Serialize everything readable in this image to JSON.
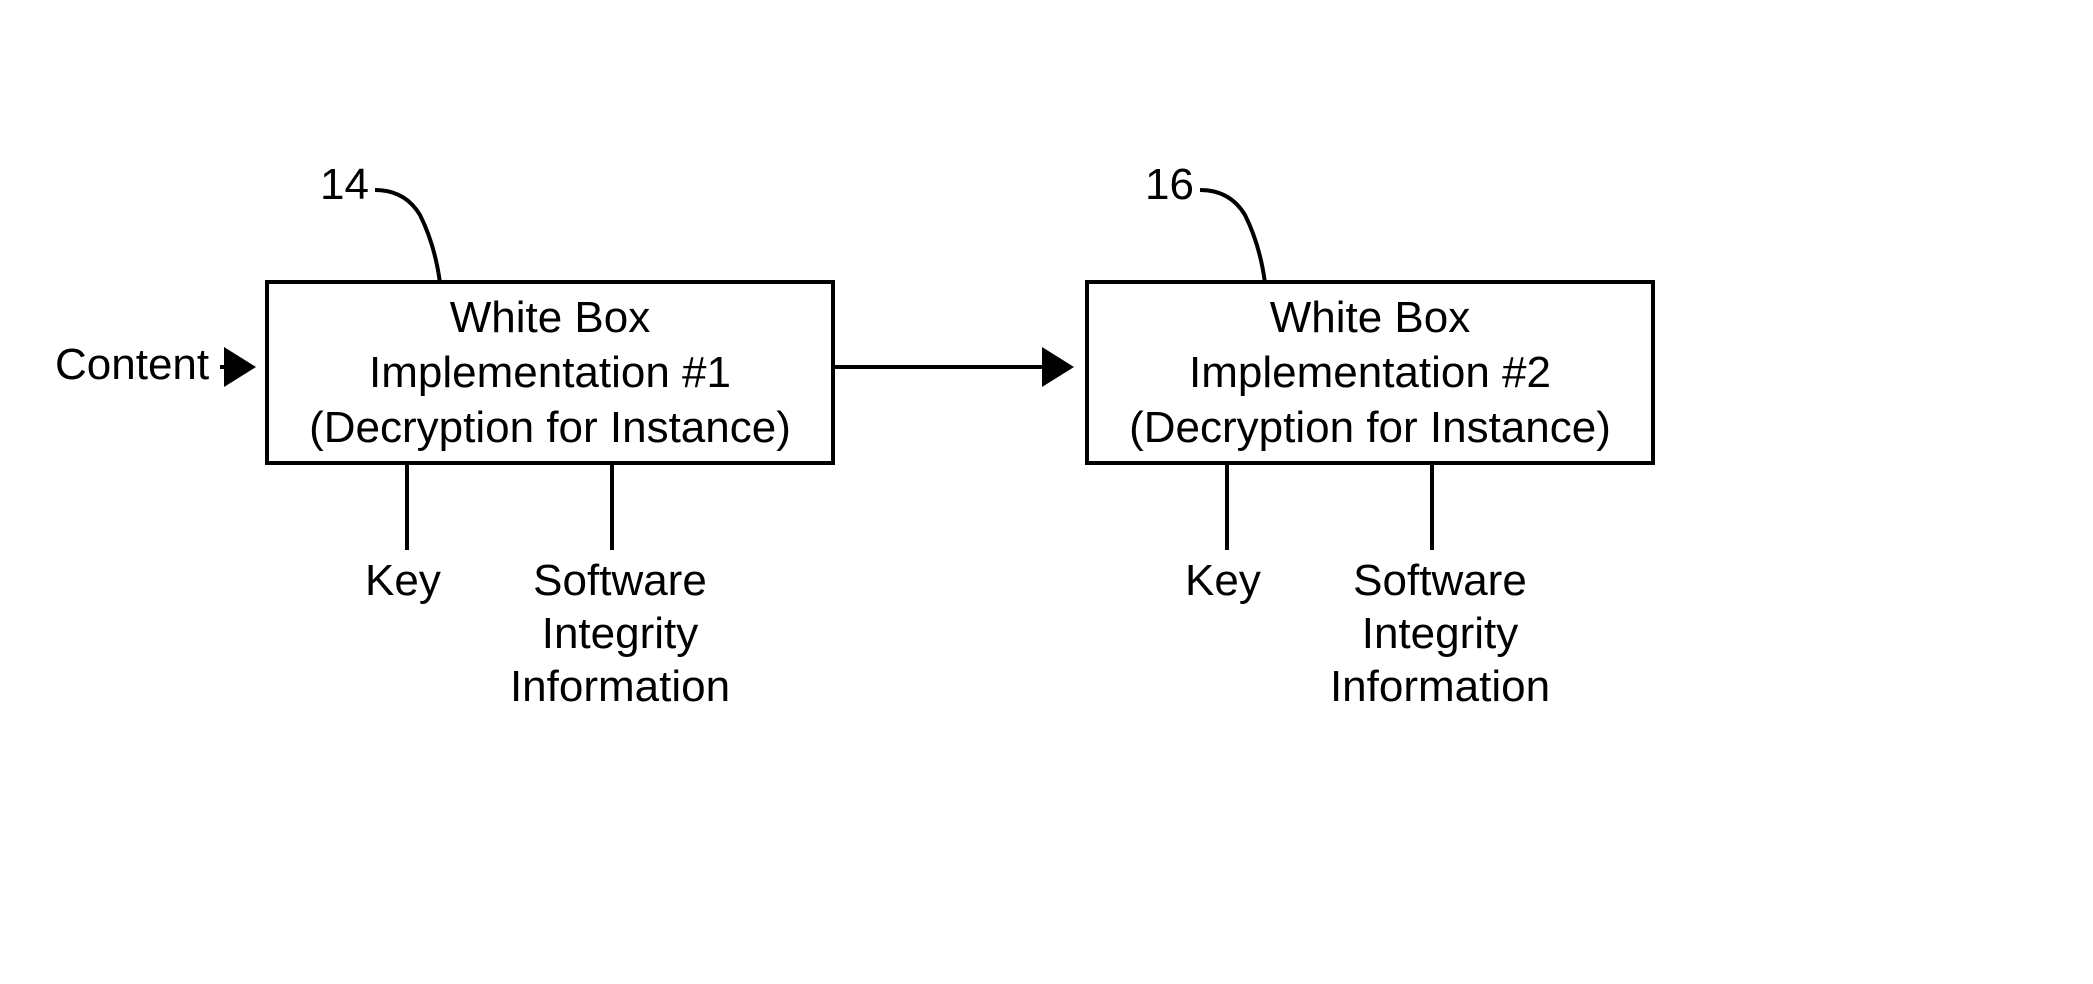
{
  "inputLabel": "Content",
  "box1": {
    "refNum": "14",
    "line1": "White Box",
    "line2": "Implementation #1",
    "line3": "(Decryption for Instance)"
  },
  "box2": {
    "refNum": "16",
    "line1": "White Box",
    "line2": "Implementation #2",
    "line3": "(Decryption for Instance)"
  },
  "keyLabel": "Key",
  "softwareLabel1": "Software",
  "softwareLabel2": "Integrity",
  "softwareLabel3": "Information"
}
